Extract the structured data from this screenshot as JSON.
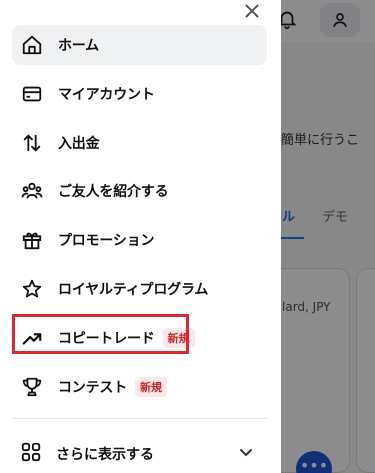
{
  "background": {
    "description_text": "を簡単に行うこ",
    "tab_active": "ル",
    "tab_inactive": "デモ",
    "card_text": "lard, JPY"
  },
  "menu": {
    "items": [
      {
        "id": "home",
        "label": "ホーム",
        "icon": "home-icon"
      },
      {
        "id": "my-account",
        "label": "マイアカウント",
        "icon": "card-icon"
      },
      {
        "id": "deposit-withdraw",
        "label": "入出金",
        "icon": "arrows-up-down-icon"
      },
      {
        "id": "refer-friend",
        "label": "ご友人を紹介する",
        "icon": "people-icon"
      },
      {
        "id": "promotion",
        "label": "プロモーション",
        "icon": "gift-icon"
      },
      {
        "id": "loyalty",
        "label": "ロイヤルティプログラム",
        "icon": "star-icon"
      },
      {
        "id": "copy-trade",
        "label": "コピートレード",
        "icon": "trend-up-icon",
        "badge": "新規"
      },
      {
        "id": "contest",
        "label": "コンテスト",
        "icon": "trophy-icon",
        "badge": "新規"
      }
    ],
    "more_label": "さらに表示する"
  },
  "colors": {
    "highlight": "#e0262f",
    "badge_bg": "#fde7ea",
    "badge_text": "#c62828"
  }
}
